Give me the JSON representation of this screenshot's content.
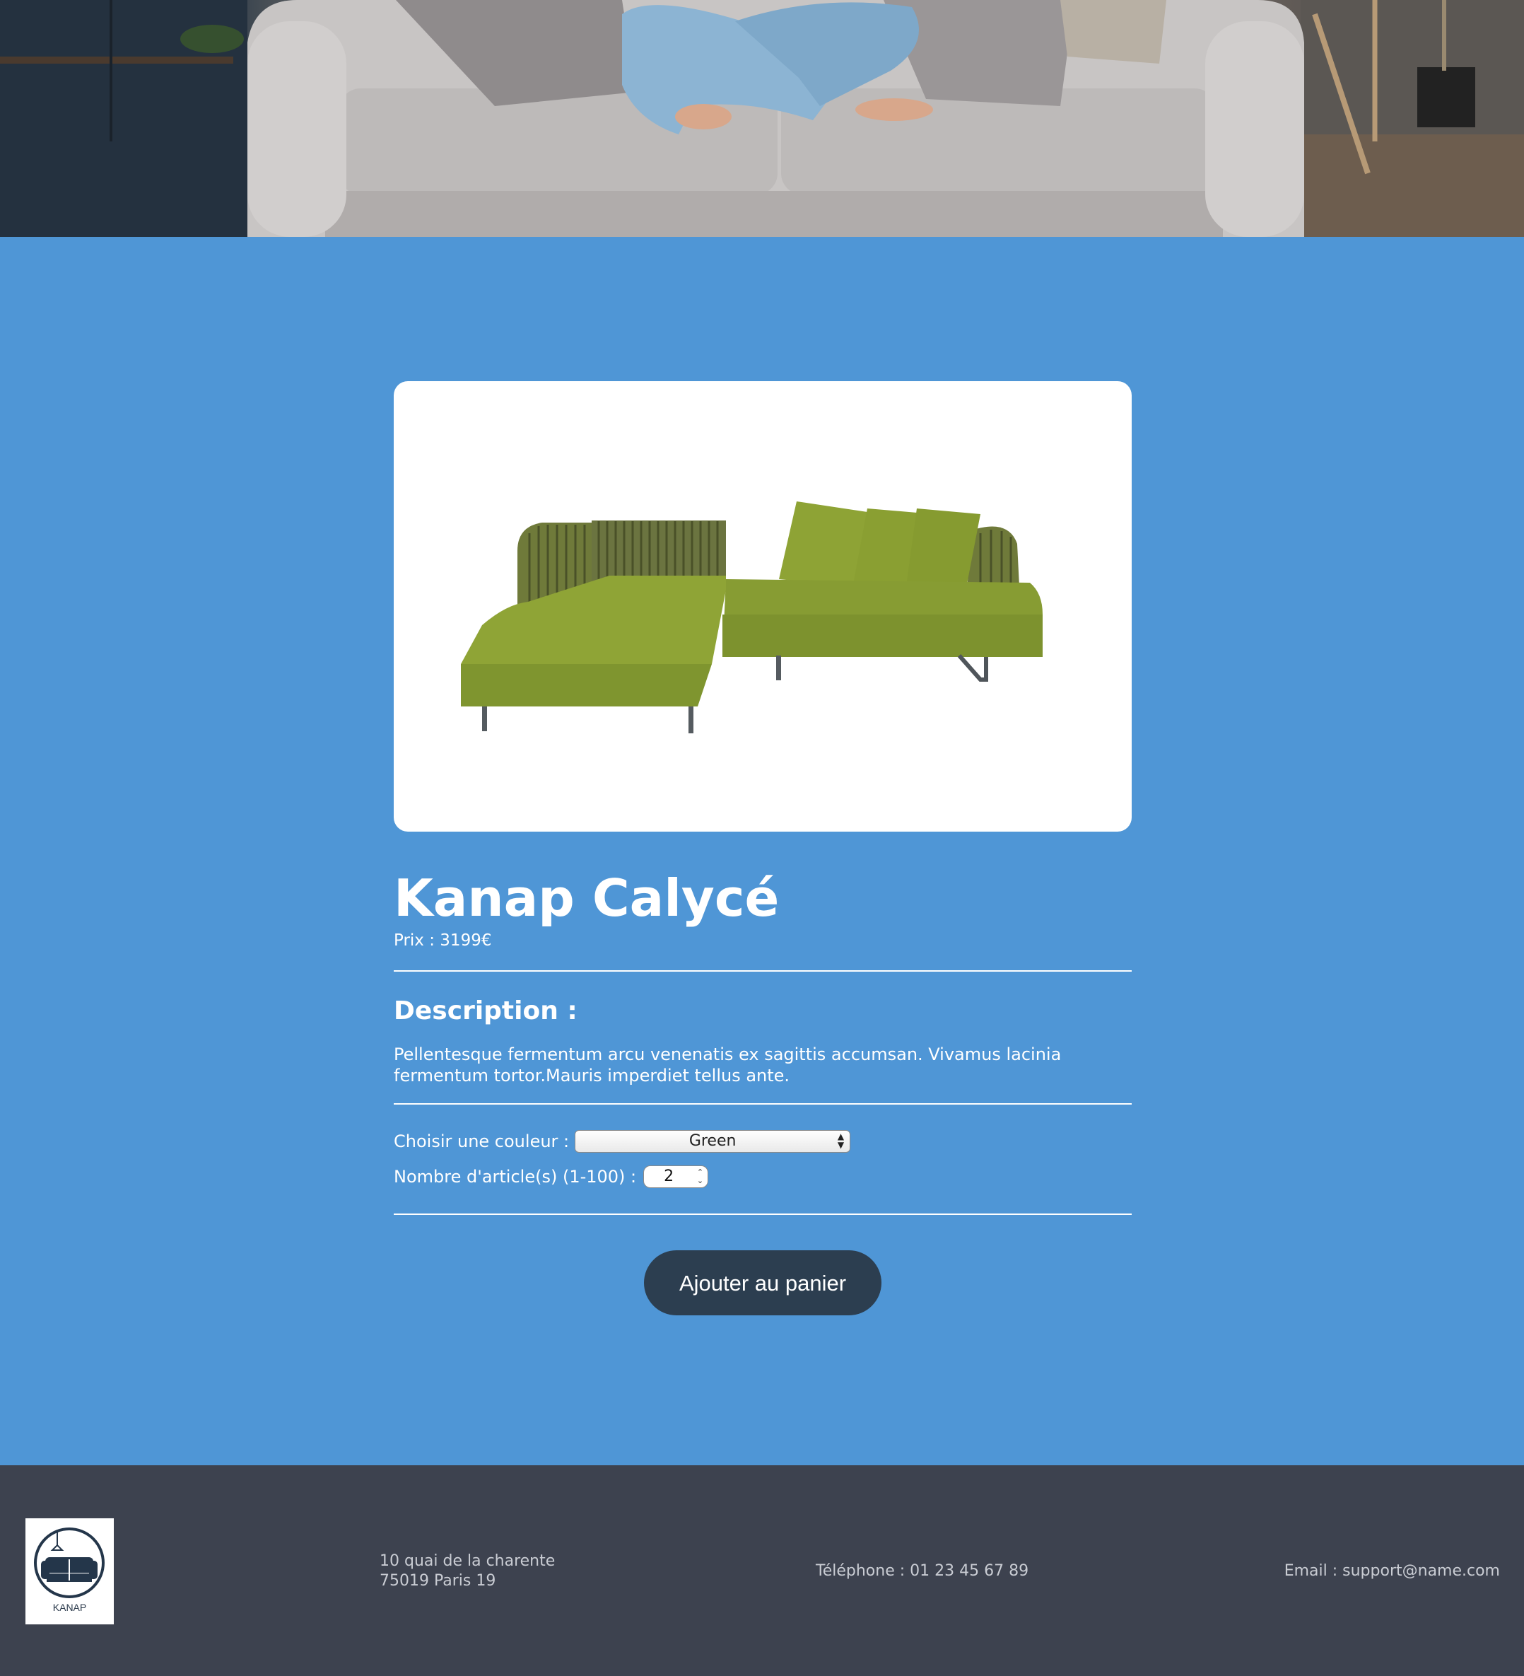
{
  "product": {
    "title": "Kanap Calycé",
    "price_label": "Prix : ",
    "price": "3199",
    "currency": "€",
    "description_title": "Description :",
    "description": "Pellentesque fermentum arcu venenatis ex sagittis accumsan. Vivamus lacinia fermentum tortor.Mauris imperdiet tellus ante.",
    "image_subject": "green L-shaped sectional sofa with striped back cushions and three green pillows"
  },
  "options": {
    "color_label": "Choisir une couleur :",
    "color_selected": "Green",
    "quantity_label": "Nombre d'article(s) (1-100) :",
    "quantity_value": "2"
  },
  "cart": {
    "add_button": "Ajouter au panier"
  },
  "footer": {
    "logo_text": "KANAP",
    "address_line1": "10 quai de la charente",
    "address_line2": "75019 Paris 19",
    "phone": "Téléphone : 01 23 45 67 89",
    "email": "Email : support@name.com"
  },
  "colors": {
    "main_background": "#4f96d6",
    "footer_background": "#3d424f",
    "button_background": "#2c3e50",
    "product_green": "#8fa435"
  },
  "hero": {
    "image_subject": "person in jeans sitting cross-legged on a light grey sofa"
  }
}
